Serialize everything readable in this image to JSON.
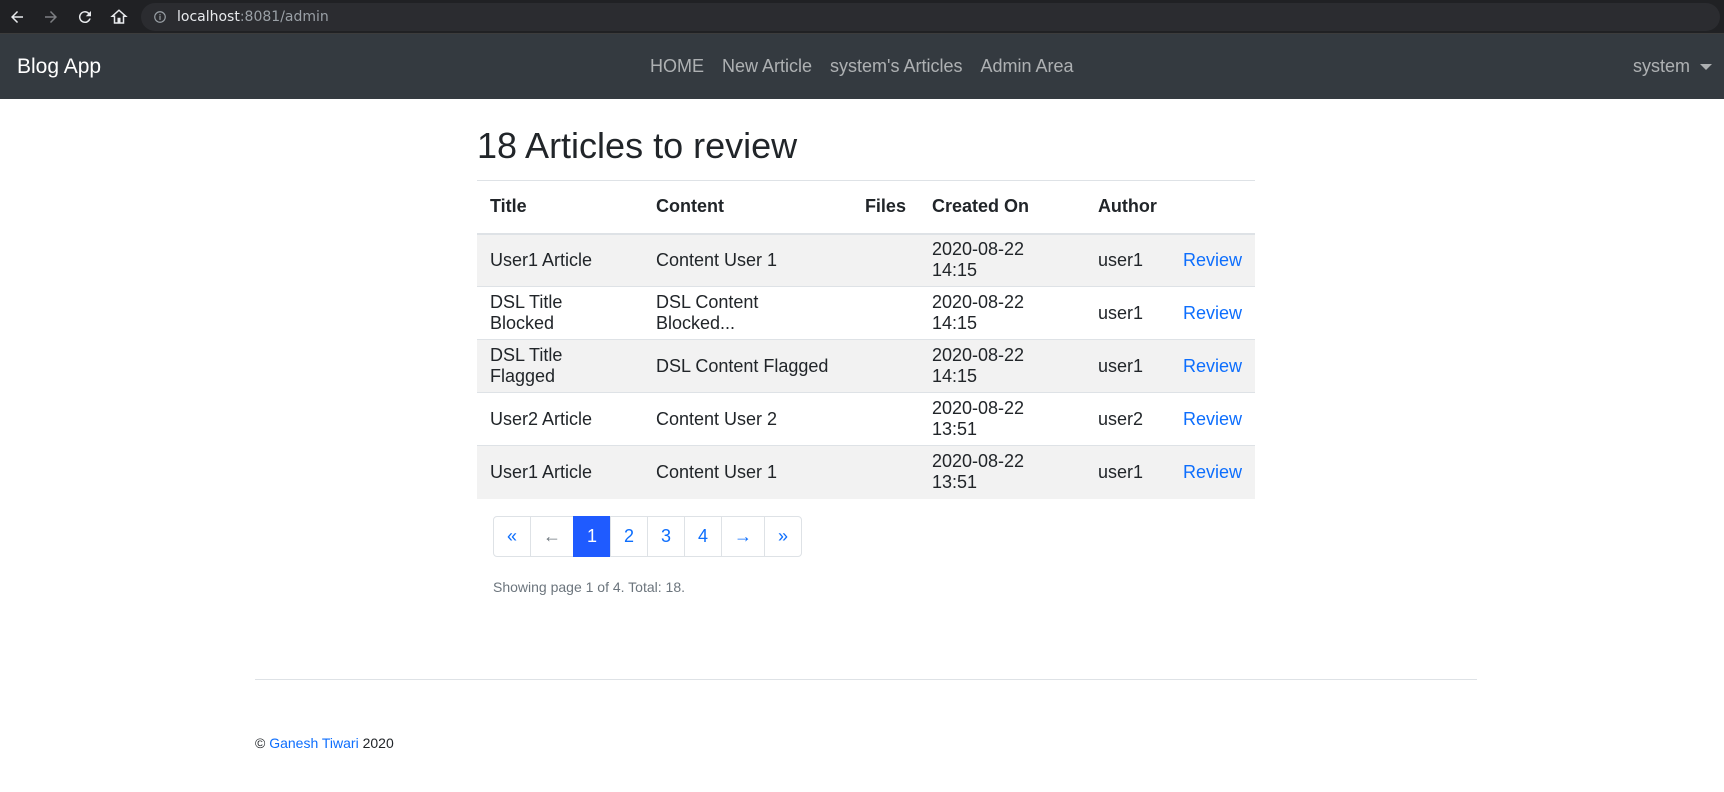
{
  "browser": {
    "url_host": "localhost",
    "url_rest": ":8081/admin",
    "icons": [
      "back-arrow-icon",
      "forward-arrow-icon",
      "reload-icon",
      "home-icon",
      "info-icon"
    ]
  },
  "navbar": {
    "brand": "Blog App",
    "links": [
      "HOME",
      "New Article",
      "system's Articles",
      "Admin Area"
    ],
    "user": "system"
  },
  "main": {
    "heading": "18 Articles to review",
    "table": {
      "headers": [
        "Title",
        "Content",
        "Files",
        "Created On",
        "Author",
        ""
      ],
      "rows": [
        {
          "title": "User1 Article",
          "content": "Content User 1",
          "files": "",
          "created": "2020-08-22 14:15",
          "author": "user1",
          "action": "Review"
        },
        {
          "title": "DSL Title Blocked",
          "content": "DSL Content Blocked...",
          "files": "",
          "created": "2020-08-22 14:15",
          "author": "user1",
          "action": "Review"
        },
        {
          "title": "DSL Title Flagged",
          "content": "DSL Content Flagged",
          "files": "",
          "created": "2020-08-22 14:15",
          "author": "user1",
          "action": "Review"
        },
        {
          "title": "User2 Article",
          "content": "Content User 2",
          "files": "",
          "created": "2020-08-22 13:51",
          "author": "user2",
          "action": "Review"
        },
        {
          "title": "User1 Article",
          "content": "Content User 1",
          "files": "",
          "created": "2020-08-22 13:51",
          "author": "user1",
          "action": "Review"
        }
      ]
    },
    "pagination": {
      "first": "«",
      "prev": "←",
      "pages": [
        "1",
        "2",
        "3",
        "4"
      ],
      "next": "→",
      "last": "»",
      "current": "1"
    },
    "page_info": "Showing page 1 of 4. Total: 18."
  },
  "footer": {
    "copyright": "©",
    "author_link": "Ganesh Tiwari",
    "year": "2020"
  },
  "colors": {
    "navbar_bg": "#343a40",
    "link": "#0d6efd",
    "active_page": "#1f5bff",
    "stripe": "#f2f2f2"
  }
}
